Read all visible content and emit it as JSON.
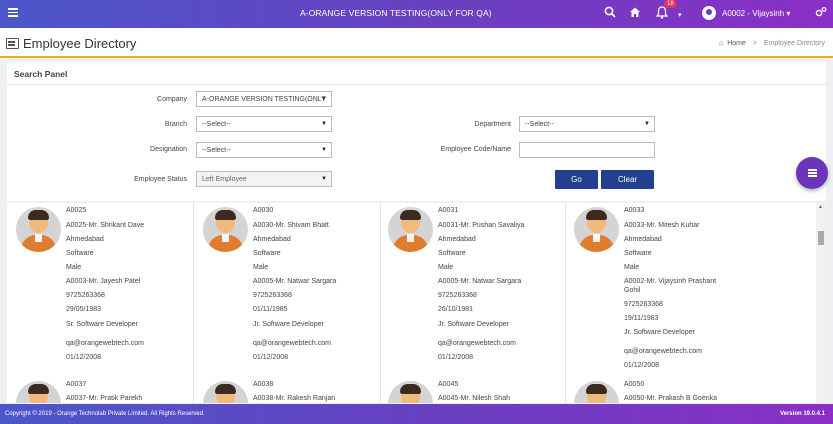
{
  "topbar": {
    "app_title": "A-ORANGE VERSION TESTING(ONLY FOR QA)",
    "notification_count": "18",
    "user_name": "A0002 - Vijaysinh",
    "caret": "▾",
    "icons": [
      "menu-icon",
      "search-icon",
      "home-icon",
      "bell-icon",
      "user-icon",
      "settings-icon"
    ]
  },
  "header": {
    "page_title": "Employee Directory",
    "breadcrumb_home": "Home",
    "breadcrumb_sep": ">",
    "breadcrumb_current": "Employee Directory"
  },
  "search": {
    "panel_title": "Search Panel",
    "company_label": "Company",
    "company_value": "A-ORANGE VERSION TESTING(ONLY",
    "branch_label": "Branch",
    "branch_value": "--Select--",
    "department_label": "Department",
    "department_value": "--Select--",
    "designation_label": "Designation",
    "designation_value": "--Select--",
    "empcode_label": "Employee Code/Name",
    "empcode_value": "",
    "status_label": "Employee Status",
    "status_value": "Left Employee",
    "go_label": "Go",
    "clear_label": "Clear"
  },
  "employees": [
    [
      "A0025",
      "A0025-Mr. Shrikant Dave",
      "Ahmedabad",
      "Software",
      "Male",
      "A0003-Mr. Jayesh Patel",
      "9725263368",
      "29/05/1983",
      "Sr. Software Developer",
      "qa@orangewebtech.com",
      "01/12/2008"
    ],
    [
      "A0030",
      "A0030-Mr. Shivam Bhatt",
      "Ahmedabad",
      "Software",
      "Male",
      "A0005-Mr. Natwar Sargara",
      "9725263368",
      "01/11/1985",
      "Jr. Software Developer",
      "qa@orangewebtech.com",
      "01/12/2008"
    ],
    [
      "A0031",
      "A0031-Mr. Pushan Savaliya",
      "Ahmedabad",
      "Software",
      "Male",
      "A0005-Mr. Natwar Sargara",
      "9725263368",
      "26/10/1981",
      "Jr. Software Developer",
      "qa@orangewebtech.com",
      "01/12/2008"
    ],
    [
      "A0033",
      "A0033-Mr. Mitesh Kuhar",
      "Ahmedabad",
      "Software",
      "Male",
      "A0002-Mr. Vijaysinh Prashant",
      "Gohil",
      "9725263368",
      "19/11/1983",
      "Jr. Software Developer",
      "qa@orangewebtech.com",
      "01/12/2008"
    ],
    [
      "A0037",
      "A0037-Mr. Pratik Parekh"
    ],
    [
      "A0038",
      "A0038-Mr. Rakesh Ranjan"
    ],
    [
      "A0045",
      "A0045-Mr. Nilesh Shah"
    ],
    [
      "A0050",
      "A0050-Mr. Prakash B Goenka"
    ]
  ],
  "footer": {
    "copyright": "Copyright © 2019 - Orange Technolab Private Limited. All Rights Reserved.",
    "version": "Version 19.0.4.1"
  }
}
